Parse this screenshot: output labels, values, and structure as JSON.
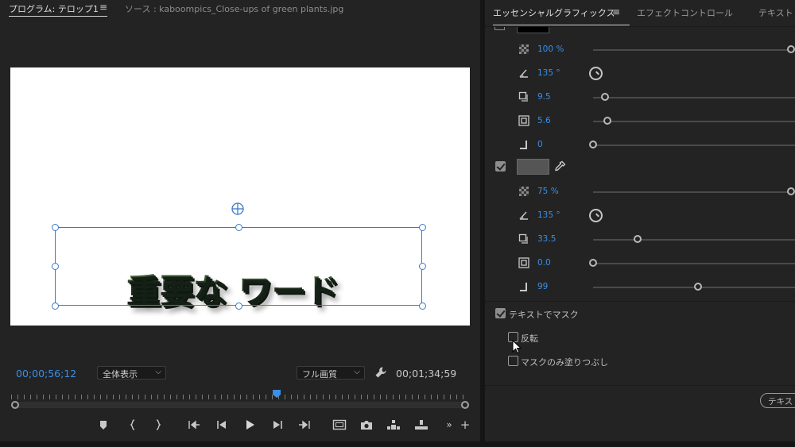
{
  "monitor": {
    "tab_program": "プログラム: テロップ1",
    "tab_menu": "≡",
    "tab_source": "ソース : kaboompics_Close-ups of green plants.jpg",
    "title_text": "重要な ワード",
    "current_timecode": "00;00;56;12",
    "zoom_select": "全体表示",
    "quality_select": "フル画質",
    "duration_timecode": "00;01;34;59",
    "playhead_position": 0.58
  },
  "panel": {
    "tab_essential": "エッセンシャルグラフィックス",
    "tab_menu": "≡",
    "tab_effect_controls": "エフェクトコントロール",
    "tab_text": "テキスト",
    "stroke_section": {
      "opacity": "100 %",
      "angle": "135 °",
      "distance": "9.5",
      "size": "5.6",
      "blur": "0",
      "opacity_level": 1.0,
      "distance_level": 0.06,
      "size_level": 0.07,
      "blur_level": 0.0
    },
    "shadow_enabled": true,
    "shadow_color": "#555555",
    "shadow_section": {
      "opacity": "75 %",
      "angle": "135 °",
      "distance": "33.5",
      "size": "0.0",
      "blur": "99",
      "opacity_level": 1.0,
      "distance_level": 0.22,
      "size_level": 0.0,
      "blur_level": 0.52
    },
    "mask_with_text": {
      "label": "テキストでマスク",
      "checked": true
    },
    "invert": {
      "label": "反転",
      "checked": false
    },
    "mask_fill_only": {
      "label": "マスクのみ塗りつぶし",
      "checked": false
    },
    "pill_button": "テキス"
  },
  "colors": {
    "accent": "#3b8fe6",
    "selection": "#3d79c7",
    "panel_bg": "#232323"
  }
}
